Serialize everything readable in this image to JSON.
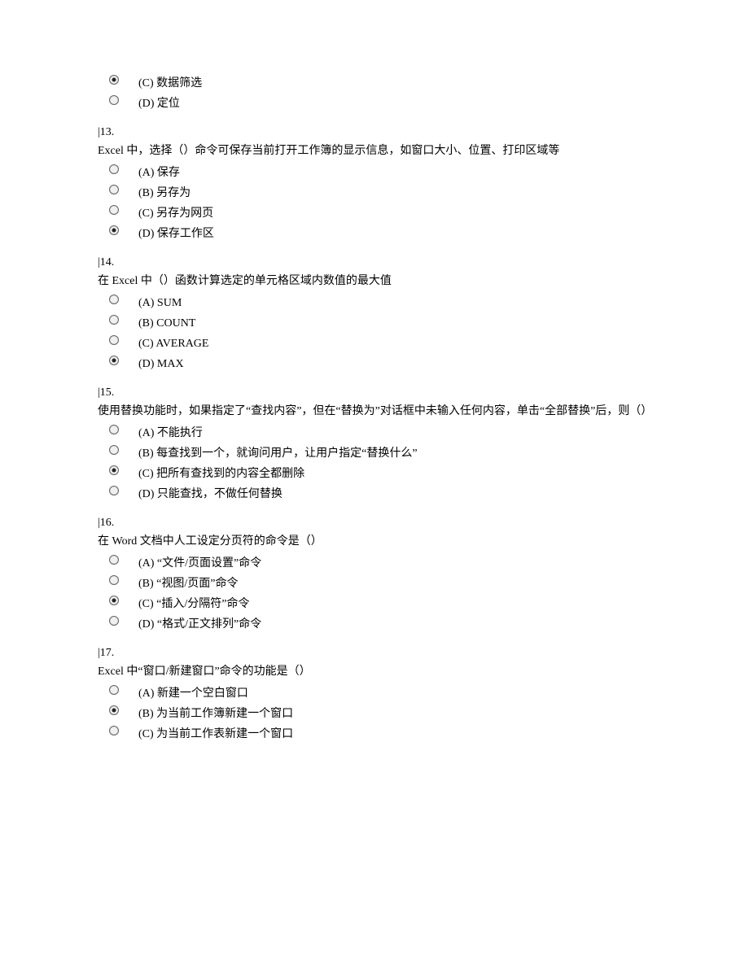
{
  "orphan_options": [
    {
      "key": "C",
      "label": "(C) 数据筛选",
      "checked": true
    },
    {
      "key": "D",
      "label": "(D) 定位",
      "checked": false
    }
  ],
  "questions": [
    {
      "num": "|13.",
      "text": "Excel 中，选择（）命令可保存当前打开工作簿的显示信息，如窗口大小、位置、打印区域等",
      "options": [
        {
          "key": "A",
          "label": "(A) 保存",
          "checked": false
        },
        {
          "key": "B",
          "label": "(B) 另存为",
          "checked": false
        },
        {
          "key": "C",
          "label": "(C) 另存为网页",
          "checked": false
        },
        {
          "key": "D",
          "label": "(D) 保存工作区",
          "checked": true
        }
      ]
    },
    {
      "num": "|14.",
      "text": "在 Excel 中（）函数计算选定的单元格区域内数值的最大值",
      "options": [
        {
          "key": "A",
          "label": "(A) SUM",
          "checked": false
        },
        {
          "key": "B",
          "label": "(B) COUNT",
          "checked": false
        },
        {
          "key": "C",
          "label": "(C) AVERAGE",
          "checked": false
        },
        {
          "key": "D",
          "label": "(D) MAX",
          "checked": true
        }
      ]
    },
    {
      "num": "|15.",
      "text": "使用替换功能时，如果指定了“查找内容”，但在“替换为”对话框中未输入任何内容，单击“全部替换”后，则（）",
      "options": [
        {
          "key": "A",
          "label": "(A) 不能执行",
          "checked": false
        },
        {
          "key": "B",
          "label": "(B) 每查找到一个，就询问用户，让用户指定“替换什么”",
          "checked": false
        },
        {
          "key": "C",
          "label": "(C) 把所有查找到的内容全都删除",
          "checked": true
        },
        {
          "key": "D",
          "label": "(D) 只能查找，不做任何替换",
          "checked": false
        }
      ]
    },
    {
      "num": "|16.",
      "text": "在 Word 文档中人工设定分页符的命令是（）",
      "options": [
        {
          "key": "A",
          "label": "(A) “文件/页面设置”命令",
          "checked": false
        },
        {
          "key": "B",
          "label": "(B) “视图/页面”命令",
          "checked": false
        },
        {
          "key": "C",
          "label": "(C) “插入/分隔符”命令",
          "checked": true
        },
        {
          "key": "D",
          "label": "(D) “格式/正文排列”命令",
          "checked": false
        }
      ]
    },
    {
      "num": "|17.",
      "text": "Excel 中“窗口/新建窗口”命令的功能是（）",
      "options": [
        {
          "key": "A",
          "label": "(A) 新建一个空白窗口",
          "checked": false
        },
        {
          "key": "B",
          "label": "(B) 为当前工作簿新建一个窗口",
          "checked": true
        },
        {
          "key": "C",
          "label": "(C) 为当前工作表新建一个窗口",
          "checked": false
        }
      ]
    }
  ]
}
